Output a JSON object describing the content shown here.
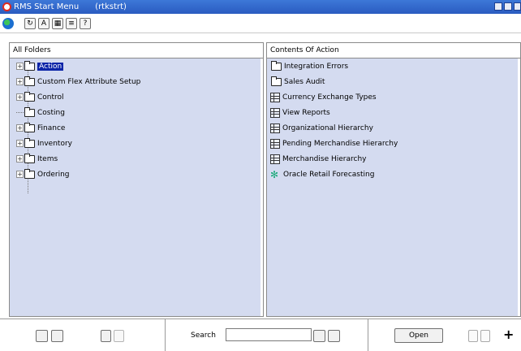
{
  "window": {
    "title": "RMS Start Menu",
    "user": "(rtkstrt)",
    "accent": "#2a5bc0"
  },
  "toolbar": {
    "icons": [
      "globe-icon",
      "refresh-icon",
      "spell-check-icon",
      "calendar-icon",
      "print-icon",
      "help-icon"
    ]
  },
  "left_panel": {
    "header": "All Folders",
    "items": [
      {
        "label": "Action",
        "expandable": true,
        "selected": true,
        "open": true
      },
      {
        "label": "Custom Flex Attribute Setup",
        "expandable": true,
        "selected": false
      },
      {
        "label": "Control",
        "expandable": true,
        "selected": false
      },
      {
        "label": "Costing",
        "expandable": false,
        "selected": false
      },
      {
        "label": "Finance",
        "expandable": true,
        "selected": false
      },
      {
        "label": "Inventory",
        "expandable": true,
        "selected": false
      },
      {
        "label": "Items",
        "expandable": true,
        "selected": false
      },
      {
        "label": "Ordering",
        "expandable": true,
        "selected": false
      }
    ]
  },
  "right_panel": {
    "header": "Contents Of Action",
    "items": [
      {
        "label": "Integration Errors",
        "icon": "folder-icon"
      },
      {
        "label": "Sales Audit",
        "icon": "folder-icon"
      },
      {
        "label": "Currency Exchange Types",
        "icon": "grid-icon"
      },
      {
        "label": "View Reports",
        "icon": "grid-icon"
      },
      {
        "label": "Organizational Hierarchy",
        "icon": "grid-icon"
      },
      {
        "label": "Pending Merchandise Hierarchy",
        "icon": "grid-icon"
      },
      {
        "label": "Merchandise Hierarchy",
        "icon": "grid-icon"
      },
      {
        "label": "Oracle Retail Forecasting",
        "icon": "star-icon"
      }
    ]
  },
  "bottom": {
    "search_label": "Search",
    "search_value": "",
    "open_label": "Open",
    "plus_label": "+"
  }
}
